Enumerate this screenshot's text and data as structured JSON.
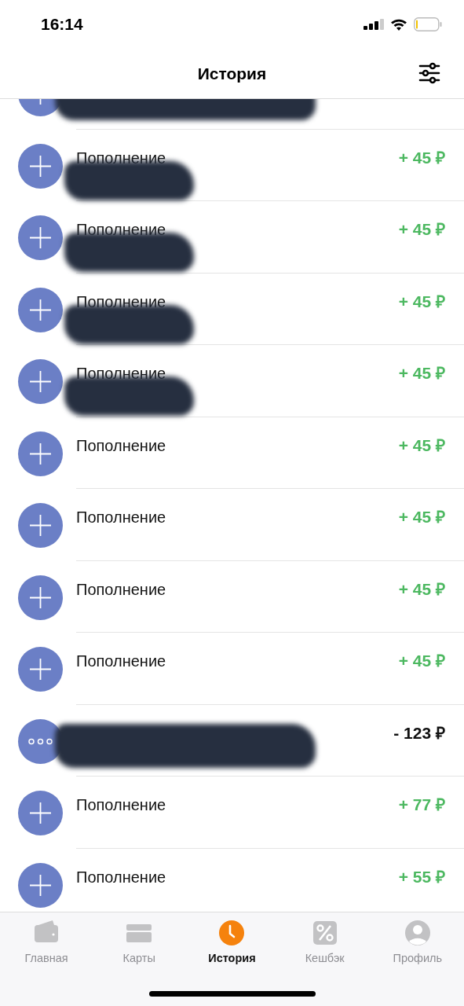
{
  "status_bar": {
    "time": "16:14"
  },
  "header": {
    "title": "История"
  },
  "transactions": [
    {
      "kind": "plus",
      "redacted": true
    },
    {
      "kind": "plus",
      "title": "Пополнение",
      "amount": "+ 45 ₽",
      "incoming": true,
      "redacted": true
    },
    {
      "kind": "plus",
      "title": "Пополнение",
      "amount": "+ 45 ₽",
      "incoming": true,
      "redacted": true
    },
    {
      "kind": "plus",
      "title": "Пополнение",
      "amount": "+ 45 ₽",
      "incoming": true,
      "redacted": true
    },
    {
      "kind": "plus",
      "title": "Пополнение",
      "amount": "+ 45 ₽",
      "incoming": true,
      "redacted": true
    },
    {
      "kind": "plus",
      "title": "Пополнение",
      "amount": "+ 45 ₽",
      "incoming": true,
      "redacted": false
    },
    {
      "kind": "plus",
      "title": "Пополнение",
      "amount": "+ 45 ₽",
      "incoming": true,
      "redacted": false
    },
    {
      "kind": "plus",
      "title": "Пополнение",
      "amount": "+ 45 ₽",
      "incoming": true,
      "redacted": false
    },
    {
      "kind": "plus",
      "title": "Пополнение",
      "amount": "+ 45 ₽",
      "incoming": true,
      "redacted": false
    },
    {
      "kind": "more",
      "amount": "- 123 ₽",
      "incoming": false,
      "redacted": true
    },
    {
      "kind": "plus",
      "title": "Пополнение",
      "amount": "+ 77 ₽",
      "incoming": true,
      "redacted": false
    },
    {
      "kind": "plus",
      "title": "Пополнение",
      "amount": "+ 55 ₽",
      "incoming": true,
      "redacted": false
    }
  ],
  "tab_bar": [
    {
      "label": "Главная",
      "selected": false
    },
    {
      "label": "Карты",
      "selected": false
    },
    {
      "label": "История",
      "selected": true
    },
    {
      "label": "Кешбэк",
      "selected": false
    },
    {
      "label": "Профиль",
      "selected": false
    }
  ]
}
